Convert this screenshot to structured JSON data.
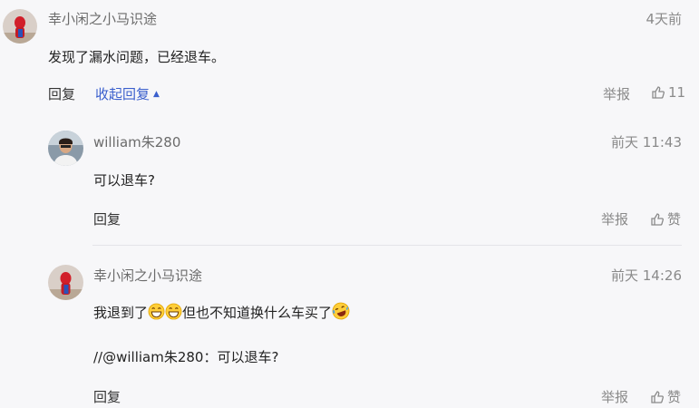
{
  "comment": {
    "username": "幸小闲之小马识途",
    "time": "4天前",
    "text": "发现了漏水问题，已经退车。",
    "reply_label": "回复",
    "collapse_label": "收起回复",
    "report_label": "举报",
    "like_count": "11"
  },
  "replies": [
    {
      "username": "william朱280",
      "time": "前天 11:43",
      "text": "可以退车?",
      "reply_label": "回复",
      "report_label": "举报",
      "like_label": "赞"
    },
    {
      "username": "幸小闲之小马识途",
      "time": "前天 14:26",
      "text_a": "我退到了",
      "text_b": "但也不知道换什么车买了",
      "quote": "//@william朱280：可以退车?",
      "reply_label": "回复",
      "report_label": "举报",
      "like_label": "赞"
    }
  ],
  "colors": {
    "accent": "#3a5fcd",
    "muted": "#8a8a8a",
    "background": "#f7f7f9"
  }
}
